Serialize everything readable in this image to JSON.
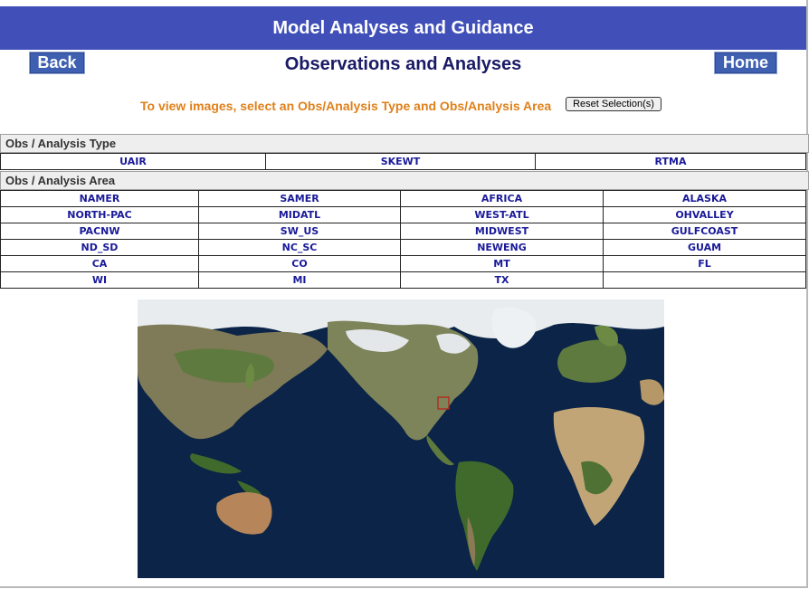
{
  "header": {
    "title": "Model Analyses and Guidance",
    "back_label": "Back",
    "home_label": "Home",
    "page_title": "Observations and Analyses"
  },
  "instructions": "To view images, select an Obs/Analysis Type and Obs/Analysis Area",
  "reset_label": "Reset Selection(s)",
  "type_section": {
    "heading": "Obs / Analysis Type",
    "items": [
      "UAIR",
      "SKEWT",
      "RTMA"
    ]
  },
  "area_section": {
    "heading": "Obs / Analysis Area",
    "rows": [
      [
        "NAMER",
        "SAMER",
        "AFRICA",
        "ALASKA"
      ],
      [
        "NORTH-PAC",
        "MIDATL",
        "WEST-ATL",
        "OHVALLEY"
      ],
      [
        "PACNW",
        "SW_US",
        "MIDWEST",
        "GULFCOAST"
      ],
      [
        "ND_SD",
        "NC_SC",
        "NEWENG",
        "GUAM"
      ],
      [
        "CA",
        "CO",
        "MT",
        "FL"
      ],
      [
        "WI",
        "MI",
        "TX",
        ""
      ]
    ]
  },
  "map": {
    "description_icon": "world-map",
    "ocean_color": "#0b2447",
    "highlight_color": "#b03020"
  }
}
